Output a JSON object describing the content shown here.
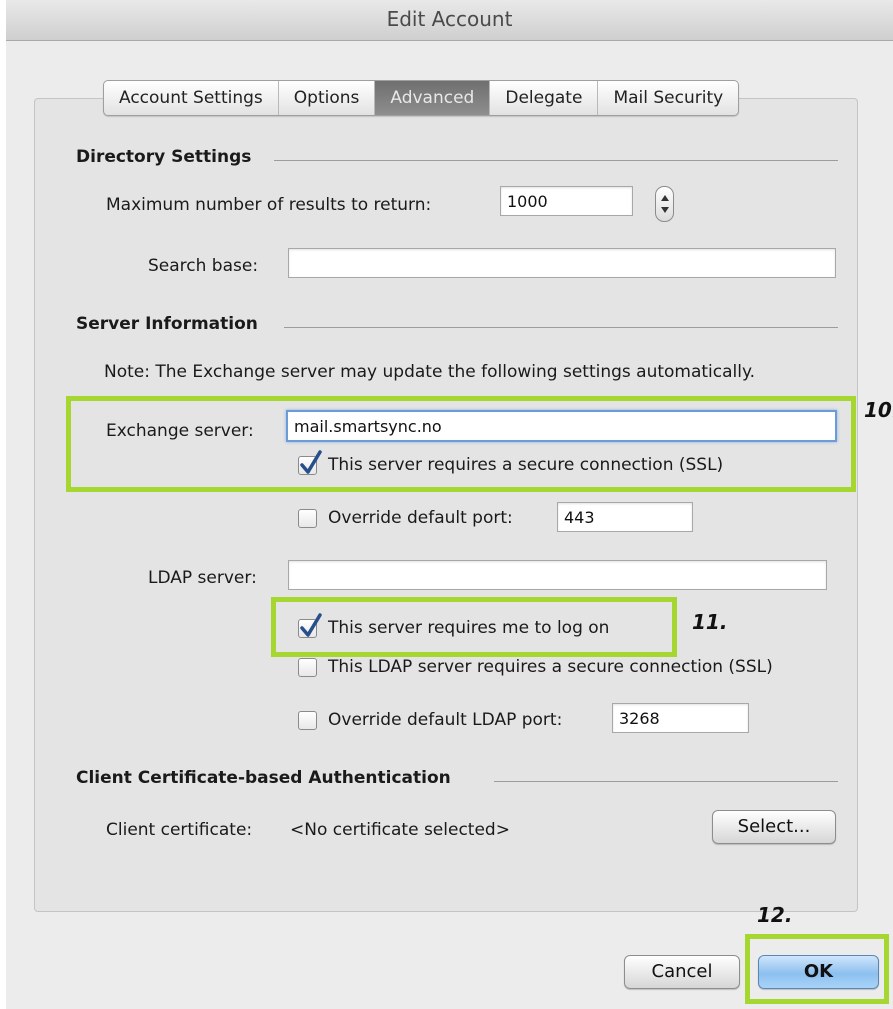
{
  "window": {
    "title": "Edit Account"
  },
  "tabs": [
    {
      "label": "Account Settings",
      "active": false
    },
    {
      "label": "Options",
      "active": false
    },
    {
      "label": "Advanced",
      "active": true
    },
    {
      "label": "Delegate",
      "active": false
    },
    {
      "label": "Mail Security",
      "active": false
    }
  ],
  "directory": {
    "heading": "Directory Settings",
    "max_results_label": "Maximum number of results to return:",
    "max_results_value": "1000",
    "search_base_label": "Search base:",
    "search_base_value": ""
  },
  "server": {
    "heading": "Server Information",
    "note": "Note: The Exchange server may update the following settings automatically.",
    "exchange_label": "Exchange server:",
    "exchange_value": "mail.smartsync.no",
    "ssl_label": "This server requires a secure connection (SSL)",
    "ssl_checked": true,
    "override_port_label": "Override default port:",
    "override_port_checked": false,
    "port_value": "443",
    "ldap_label": "LDAP server:",
    "ldap_value": "",
    "logon_label": "This server requires me to log on",
    "logon_checked": true,
    "ldap_ssl_label": "This LDAP server requires a secure connection (SSL)",
    "ldap_ssl_checked": false,
    "override_ldap_port_label": "Override default LDAP port:",
    "override_ldap_port_checked": false,
    "ldap_port_value": "3268"
  },
  "cert": {
    "heading": "Client Certificate-based Authentication",
    "label": "Client certificate:",
    "value": "<No certificate selected>",
    "select_button": "Select..."
  },
  "annotations": {
    "step10": "10.",
    "step11": "11.",
    "step12": "12."
  },
  "buttons": {
    "cancel": "Cancel",
    "ok": "OK"
  },
  "colors": {
    "highlight": "#a6d630",
    "default_button": "#8dc0ef"
  }
}
